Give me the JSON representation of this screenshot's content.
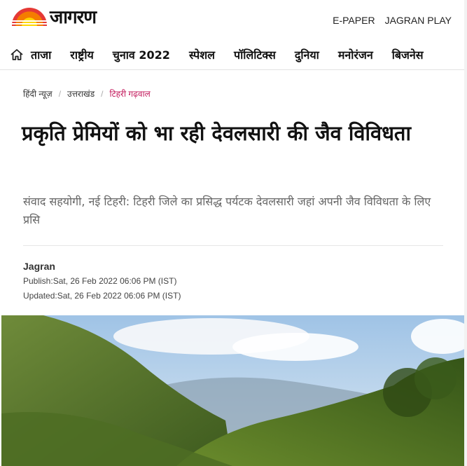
{
  "brand": {
    "name": "जागरण"
  },
  "top_links": [
    "E-PAPER",
    "JAGRAN PLAY"
  ],
  "nav": {
    "home_icon": "home-icon",
    "items": [
      "ताजा",
      "राष्ट्रीय",
      "चुनाव 2022",
      "स्पेशल",
      "पॉलिटिक्स",
      "दुनिया",
      "मनोरंजन",
      "बिजनेस"
    ]
  },
  "breadcrumb": [
    "हिंदी न्यूज़",
    "उत्तराखंड",
    "टिहरी गढ़वाल"
  ],
  "article": {
    "title": "प्रकृति प्रेमियों को भा रही देवलसारी की जैव विविधता",
    "summary": "संवाद सहयोगी, नई टिहरी: टिहरी जिले का प्रसिद्ध पर्यटक देवलसारी जहां अपनी जैव विविधता के लिए प्रसि",
    "author": "Jagran",
    "publish": "Publish:Sat, 26 Feb 2022 06:06 PM (IST)",
    "updated": "Updated:Sat, 26 Feb 2022 06:06 PM (IST)"
  },
  "colors": {
    "accent": "#c2185b",
    "logo_red": "#e53935",
    "logo_orange": "#f57c00",
    "logo_yellow": "#ffd600"
  }
}
